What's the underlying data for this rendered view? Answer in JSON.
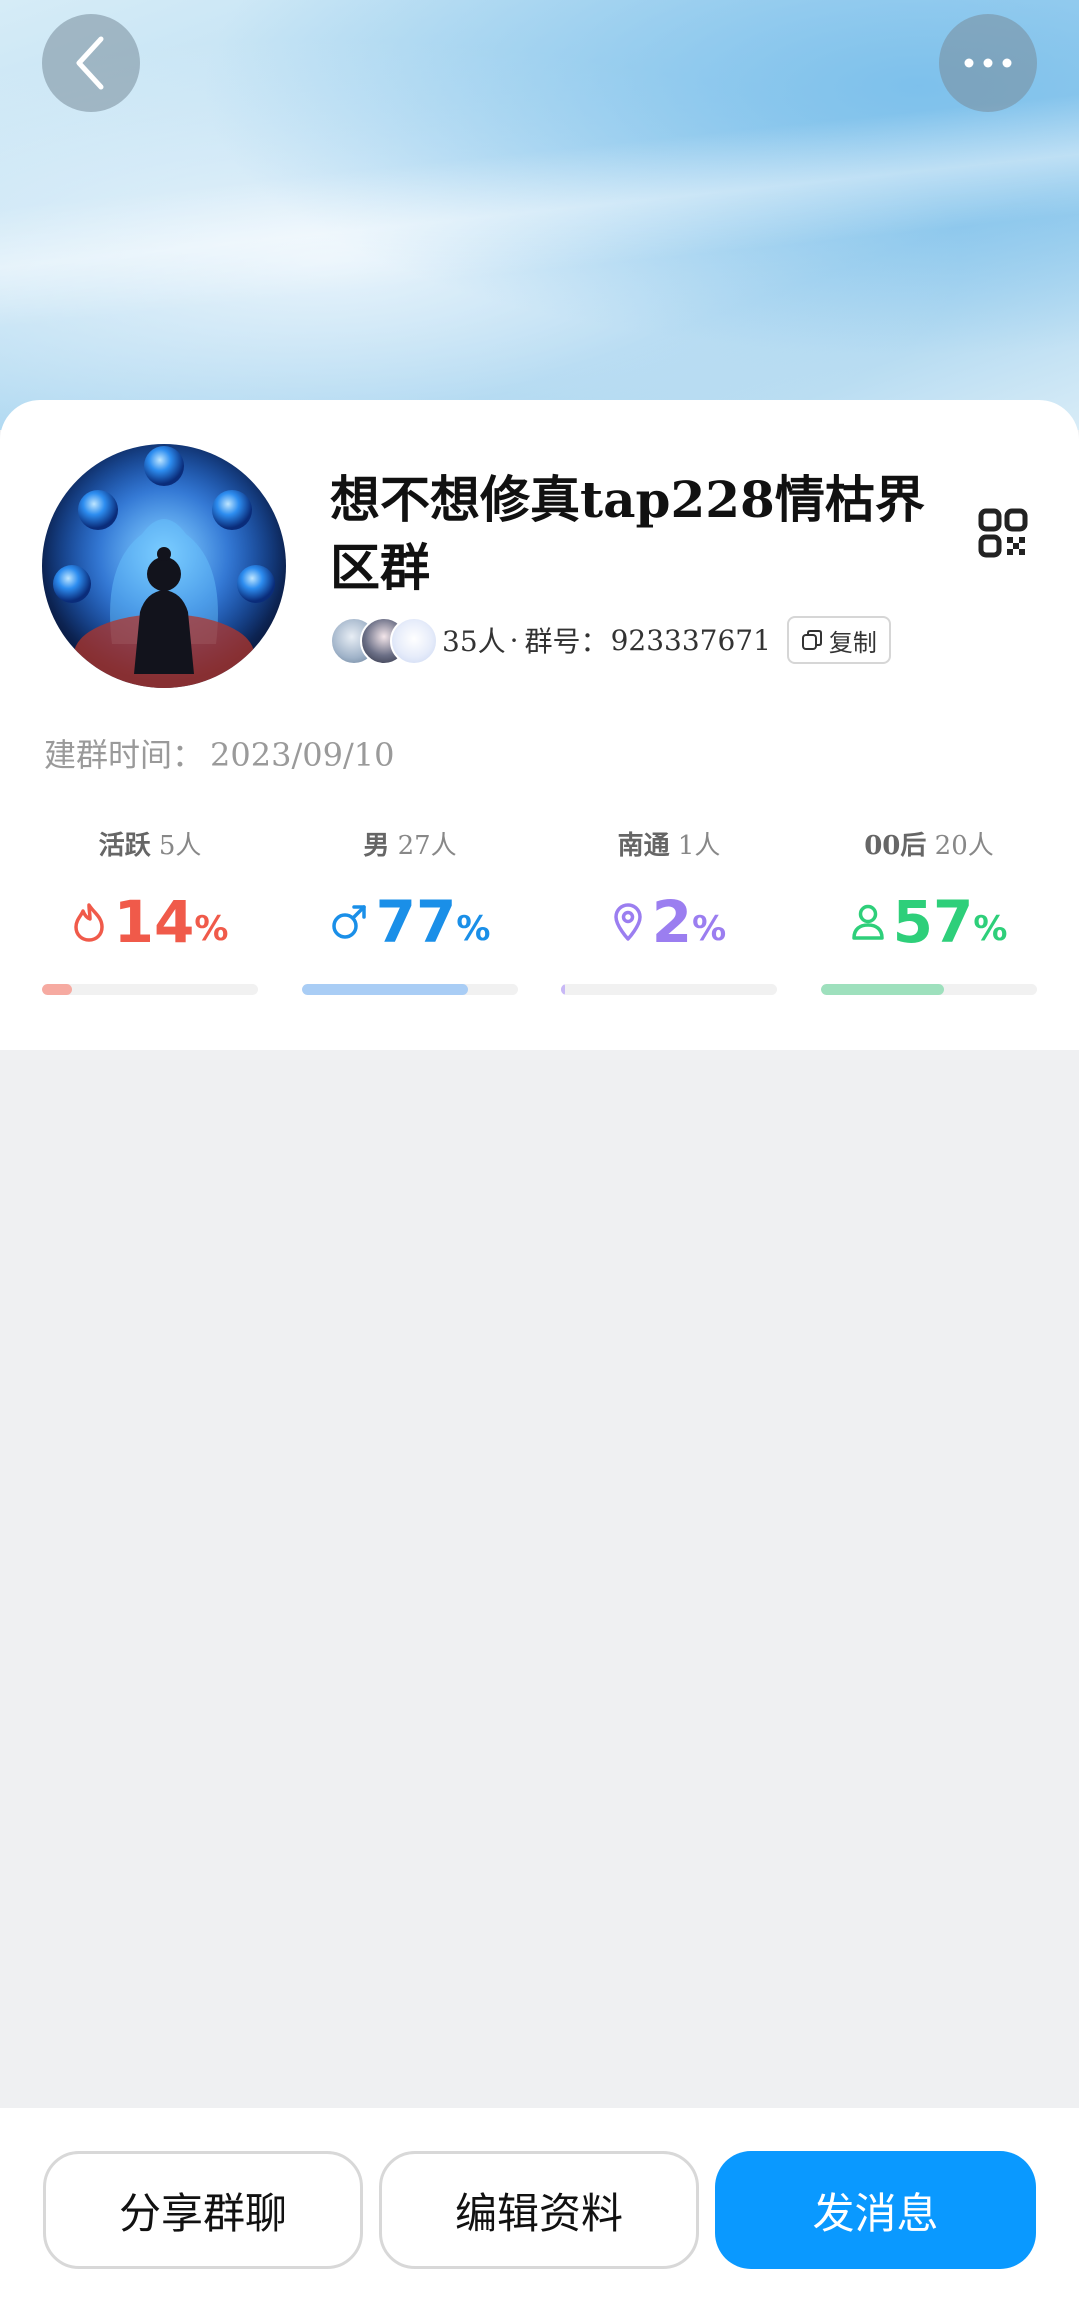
{
  "header": {
    "back_icon": "chevron-left-icon",
    "more_icon": "ellipsis-icon"
  },
  "group": {
    "name": "想不想修真tap228情枯界区群",
    "member_count_text": "35人",
    "dot": "·",
    "group_id_label": "群号：",
    "group_id": "923337671",
    "copy_label": "复制",
    "created_label": "建群时间：",
    "created_date": "2023/09/10"
  },
  "stats": [
    {
      "label_bold": "活跃",
      "label_rest": "5人",
      "value": "14",
      "unit": "%",
      "fraction": 0.14,
      "color": "#f05a4a",
      "bar_color": "#f6aaa1",
      "icon": "flame-icon"
    },
    {
      "label_bold": "男",
      "label_rest": "27人",
      "value": "77",
      "unit": "%",
      "fraction": 0.77,
      "color": "#1a8fe8",
      "bar_color": "#a9cdf5",
      "icon": "male-icon"
    },
    {
      "label_bold": "南通",
      "label_rest": "1人",
      "value": "2",
      "unit": "%",
      "fraction": 0.02,
      "color": "#9b7ef0",
      "bar_color": "#c8b8f6",
      "icon": "location-pin-icon"
    },
    {
      "label_bold": "00后",
      "label_rest": "20人",
      "value": "57",
      "unit": "%",
      "fraction": 0.57,
      "color": "#2ecf7a",
      "bar_color": "#9ee0bd",
      "icon": "person-icon"
    }
  ],
  "actions": {
    "share": "分享群聊",
    "edit": "编辑资料",
    "send": "发消息"
  },
  "colors": {
    "primary": "#0a99ff"
  }
}
